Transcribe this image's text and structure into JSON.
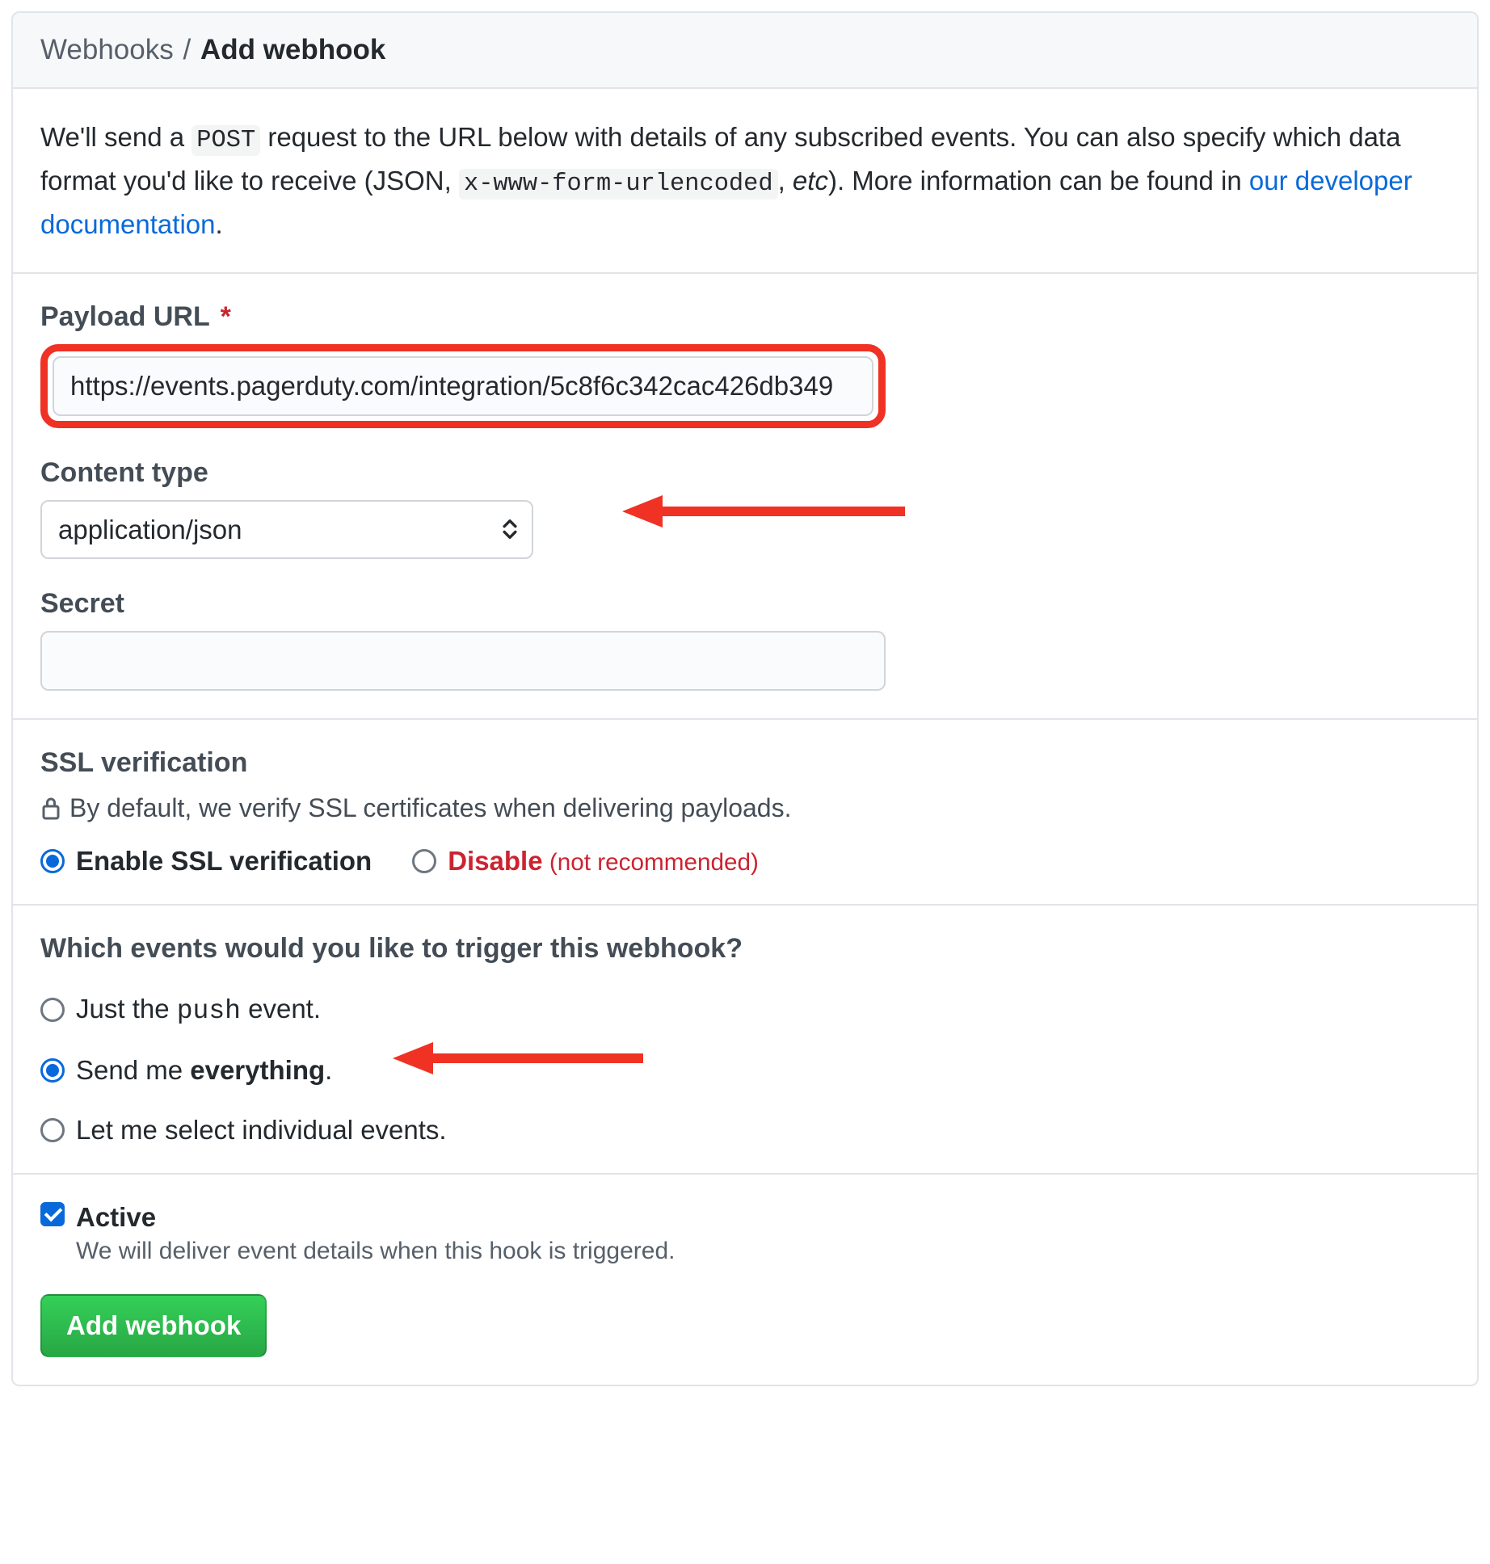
{
  "breadcrumb": {
    "parent": "Webhooks",
    "current": "Add webhook"
  },
  "intro": {
    "t1": "We'll send a ",
    "code1": "POST",
    "t2": " request to the URL below with details of any subscribed events. You can also specify which data format you'd like to receive (JSON, ",
    "code2": "x-www-form-urlencoded",
    "t3": ", ",
    "italic": "etc",
    "t4": "). More information can be found in ",
    "link": "our developer documentation",
    "t5": "."
  },
  "form": {
    "payload_url": {
      "label": "Payload URL",
      "required": "*",
      "value": "https://events.pagerduty.com/integration/5c8f6c342cac426db349"
    },
    "content_type": {
      "label": "Content type",
      "value": "application/json"
    },
    "secret": {
      "label": "Secret",
      "value": ""
    }
  },
  "ssl": {
    "title": "SSL verification",
    "hint": "By default, we verify SSL certificates when delivering payloads.",
    "enable_label": "Enable SSL verification",
    "disable_label": "Disable",
    "disable_note": " (not recommended)"
  },
  "events": {
    "title": "Which events would you like to trigger this webhook?",
    "opt_push_pre": "Just the ",
    "opt_push_code": "push",
    "opt_push_post": " event.",
    "opt_everything_pre": "Send me ",
    "opt_everything_bold": "everything",
    "opt_everything_post": ".",
    "opt_individual": "Let me select individual events."
  },
  "active": {
    "label": "Active",
    "desc": "We will deliver event details when this hook is triggered."
  },
  "submit_label": "Add webhook"
}
